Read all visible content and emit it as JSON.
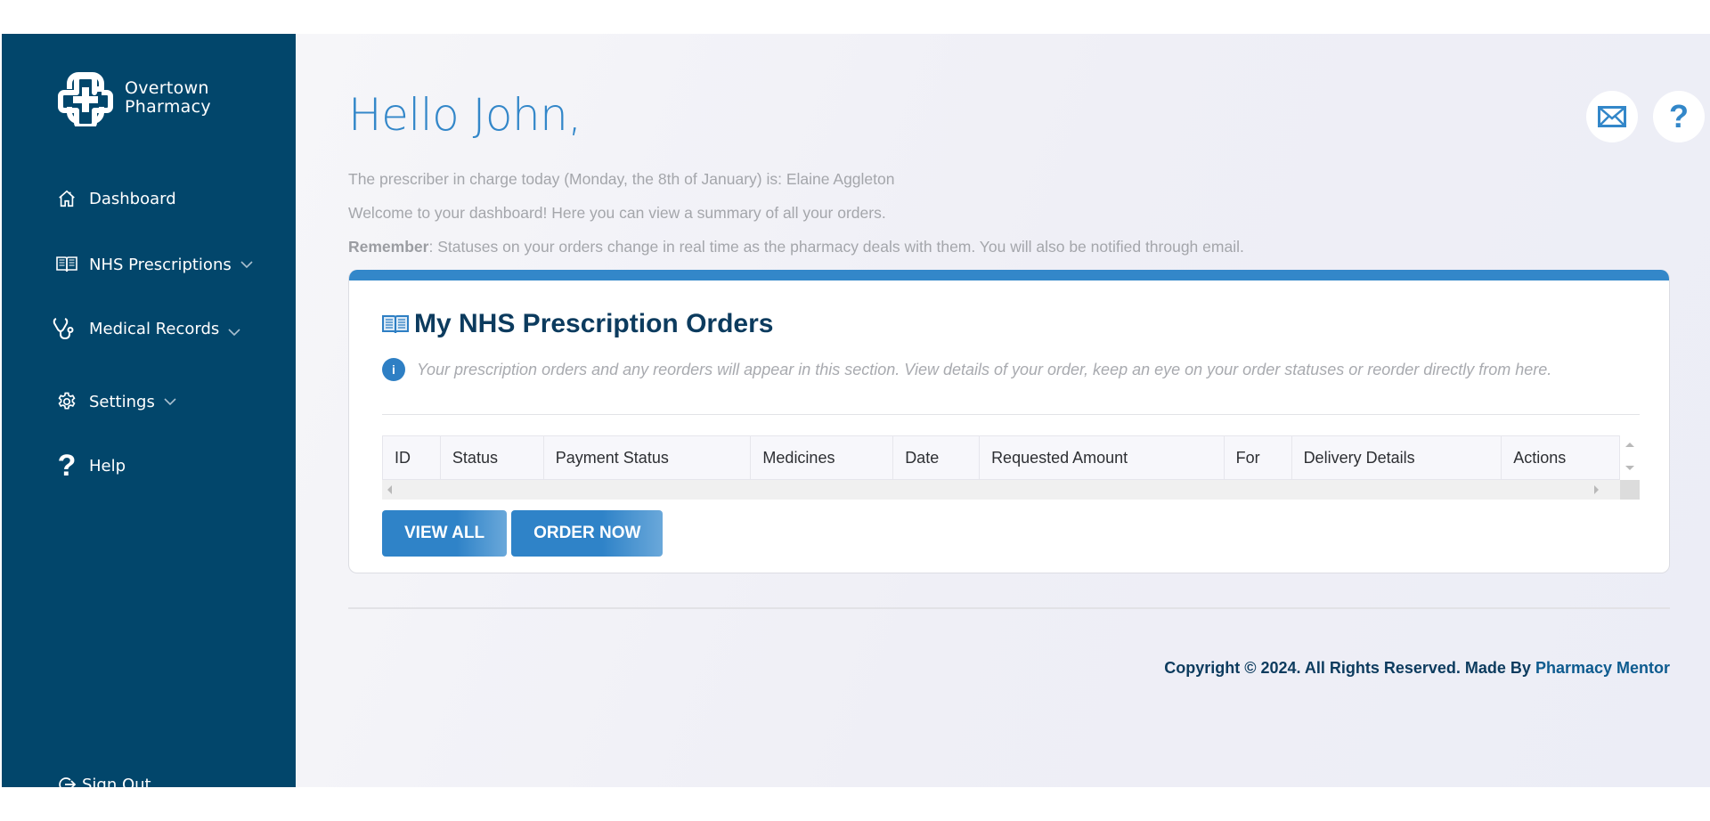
{
  "brand": {
    "line1": "Overtown",
    "line2": "Pharmacy"
  },
  "sidebar": {
    "items": [
      {
        "label": "Dashboard",
        "icon": "home-icon",
        "has_chevron": false
      },
      {
        "label": "NHS Prescriptions",
        "icon": "book-icon",
        "has_chevron": true
      },
      {
        "label": "Medical Records",
        "icon": "stethoscope-icon",
        "has_chevron": true
      },
      {
        "label": "Settings",
        "icon": "gear-icon",
        "has_chevron": true
      },
      {
        "label": "Help",
        "icon": "question-icon",
        "has_chevron": false
      }
    ],
    "signout_label": "Sign Out"
  },
  "header": {
    "greeting": "Hello John,",
    "prescriber_line": "The prescriber in charge today (Monday, the 8th of January) is: Elaine Aggleton",
    "welcome_line": "Welcome to your dashboard! Here you can view a summary of all your orders.",
    "remember_label": "Remember",
    "remember_text": ": Statuses on your orders change in real time as the pharmacy deals with them. You will also be notified through email.",
    "mail_icon": "mail-icon",
    "help_icon": "question-icon",
    "help_glyph": "?"
  },
  "orders_card": {
    "title": "My NHS Prescription Orders",
    "info_glyph": "i",
    "note": "Your prescription orders and any reorders will appear in this section. View details of your order, keep an eye on your order statuses or reorder directly from here.",
    "columns": [
      "ID",
      "Status",
      "Payment Status",
      "Medicines",
      "Date",
      "Requested Amount",
      "For",
      "Delivery Details",
      "Actions"
    ],
    "rows": [],
    "buttons": {
      "view_all": "VIEW ALL",
      "order_now": "ORDER NOW"
    }
  },
  "footer": {
    "copyright": "Copyright © 2024. All Rights Reserved. Made By ",
    "link": "Pharmacy Mentor"
  },
  "colors": {
    "sidebar": "#02466b",
    "accent": "#3387c9",
    "title": "#0c3b5e"
  }
}
